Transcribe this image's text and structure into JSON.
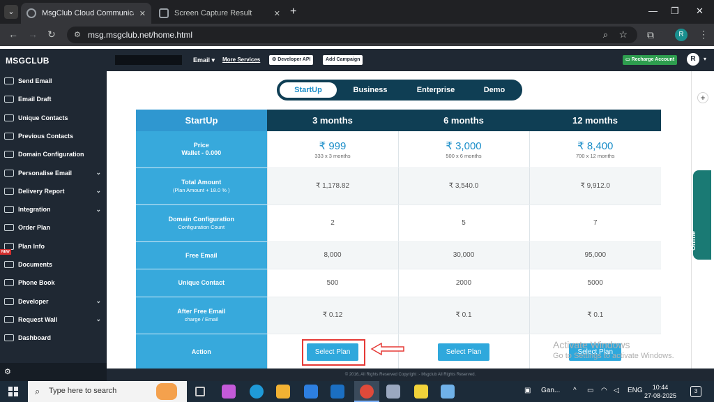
{
  "browser": {
    "tabs": [
      {
        "title": "MsgClub Cloud Communication"
      },
      {
        "title": "Screen Capture Result"
      }
    ],
    "url": "msg.msgclub.net/home.html",
    "profile_initial": "R"
  },
  "sidebar": {
    "brand": "MSGCLUB",
    "new_badge": "NEW",
    "items": [
      {
        "label": "Send Email",
        "chevron": false
      },
      {
        "label": "Email Draft",
        "chevron": false
      },
      {
        "label": "Unique Contacts",
        "chevron": false
      },
      {
        "label": "Previous Contacts",
        "chevron": false
      },
      {
        "label": "Domain Configuration",
        "chevron": false
      },
      {
        "label": "Personalise Email",
        "chevron": true
      },
      {
        "label": "Delivery Report",
        "chevron": true
      },
      {
        "label": "Integration",
        "chevron": true
      },
      {
        "label": "Order Plan",
        "chevron": false
      },
      {
        "label": "Plan Info",
        "chevron": false
      },
      {
        "label": "Documents",
        "chevron": false
      },
      {
        "label": "Phone Book",
        "chevron": false
      },
      {
        "label": "Developer",
        "chevron": true
      },
      {
        "label": "Request Wall",
        "chevron": true
      },
      {
        "label": "Dashboard",
        "chevron": false
      }
    ]
  },
  "header": {
    "email_dropdown": "Email",
    "more_services": "More Services",
    "developer_api": "Developer API",
    "add_campaign": "Add Campaign",
    "recharge": "Recharge Account",
    "user_initial": "R"
  },
  "plan_tabs": [
    "StartUp",
    "Business",
    "Enterprise",
    "Demo"
  ],
  "table": {
    "corner": "StartUp",
    "columns": [
      "3 months",
      "6 months",
      "12 months"
    ],
    "price": {
      "label": "Price",
      "sub": "Wallet - 0.000",
      "values": [
        {
          "main": "₹ 999",
          "sub": "333 x 3 months"
        },
        {
          "main": "₹ 3,000",
          "sub": "500 x 6 months"
        },
        {
          "main": "₹ 8,400",
          "sub": "700 x 12 months"
        }
      ]
    },
    "rows": [
      {
        "label": "Total Amount",
        "sub": "(Plan Amount + 18.0 % )",
        "values": [
          "₹ 1,178.82",
          "₹ 3,540.0",
          "₹ 9,912.0"
        ]
      },
      {
        "label": "Domain Configuration",
        "sub": "Configuration Count",
        "values": [
          "2",
          "5",
          "7"
        ]
      },
      {
        "label": "Free Email",
        "sub": "",
        "values": [
          "8,000",
          "30,000",
          "95,000"
        ]
      },
      {
        "label": "Unique Contact",
        "sub": "",
        "values": [
          "500",
          "2000",
          "5000"
        ]
      },
      {
        "label": "After Free Email",
        "sub": "charge / Email",
        "values": [
          "₹ 0.12",
          "₹ 0.1",
          "₹ 0.1"
        ]
      }
    ],
    "action": {
      "label": "Action",
      "button": "Select Plan"
    }
  },
  "right_panel": {
    "online": "Online",
    "plus": "+"
  },
  "watermark": {
    "line1": "Activate Windows",
    "line2": "Go to Settings to activate Windows."
  },
  "footer": "© 2016, All Rights Reserved Copyright :- Msgclub All Rights Reserved.",
  "taskbar": {
    "search_placeholder": "Type here to search",
    "tray_app": "Gan...",
    "language": "ENG",
    "time": "10:44",
    "date": "27-08-2025",
    "notifications": "3"
  }
}
